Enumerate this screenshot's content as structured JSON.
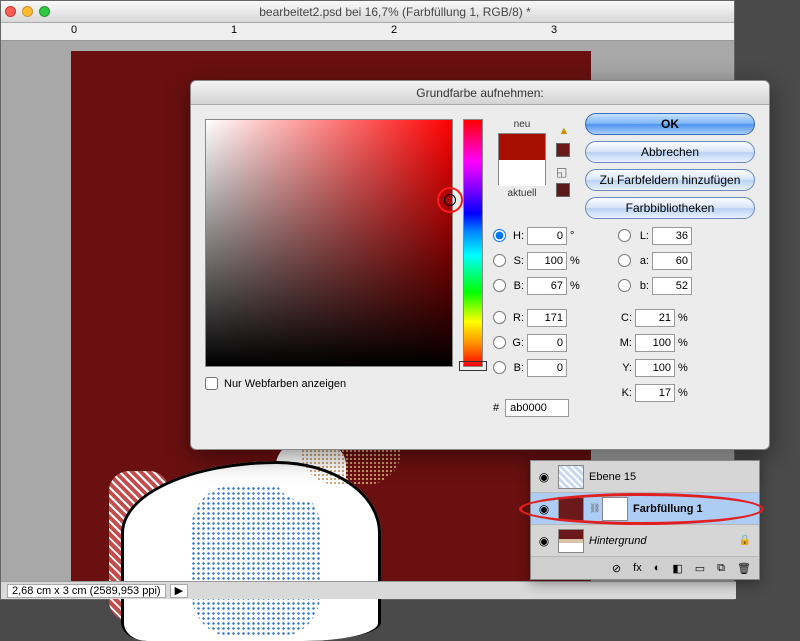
{
  "doc": {
    "title": "bearbeitet2.psd bei 16,7% (Farbfüllung 1, RGB/8) *",
    "ruler_marks": [
      "0",
      "1",
      "2",
      "3"
    ],
    "status": "2,68 cm x 3 cm (2589,953 ppi)",
    "scroll_hint": "▶"
  },
  "picker": {
    "title": "Grundfarbe aufnehmen:",
    "new_label": "neu",
    "current_label": "aktuell",
    "buttons": {
      "ok": "OK",
      "cancel": "Abbrechen",
      "add": "Zu Farbfeldern hinzufügen",
      "libs": "Farbbibliotheken"
    },
    "webonly_label": "Nur Webfarben anzeigen",
    "hsb": {
      "H": "0",
      "S": "100",
      "B": "67"
    },
    "lab": {
      "L": "36",
      "a": "60",
      "b": "52"
    },
    "rgb": {
      "R": "171",
      "G": "0",
      "B": "0"
    },
    "cmyk": {
      "C": "21",
      "M": "100",
      "Y": "100",
      "K": "17"
    },
    "hex": "ab0000",
    "units": {
      "deg": "°",
      "pct": "%"
    },
    "labels": {
      "H": "H:",
      "S": "S:",
      "Bhsb": "B:",
      "L": "L:",
      "a": "a:",
      "b": "b:",
      "R": "R:",
      "G": "G:",
      "Brgb": "B:",
      "C": "C:",
      "M": "M:",
      "Y": "Y:",
      "K": "K:",
      "hash": "#"
    }
  },
  "layers": {
    "items": [
      {
        "name": "Ebene 15"
      },
      {
        "name": "Farbfüllung 1"
      },
      {
        "name": "Hintergrund"
      }
    ],
    "foot_icons": [
      "⊘",
      "fx",
      "◐",
      "◧",
      "▭",
      "⧉",
      "🗑"
    ]
  }
}
